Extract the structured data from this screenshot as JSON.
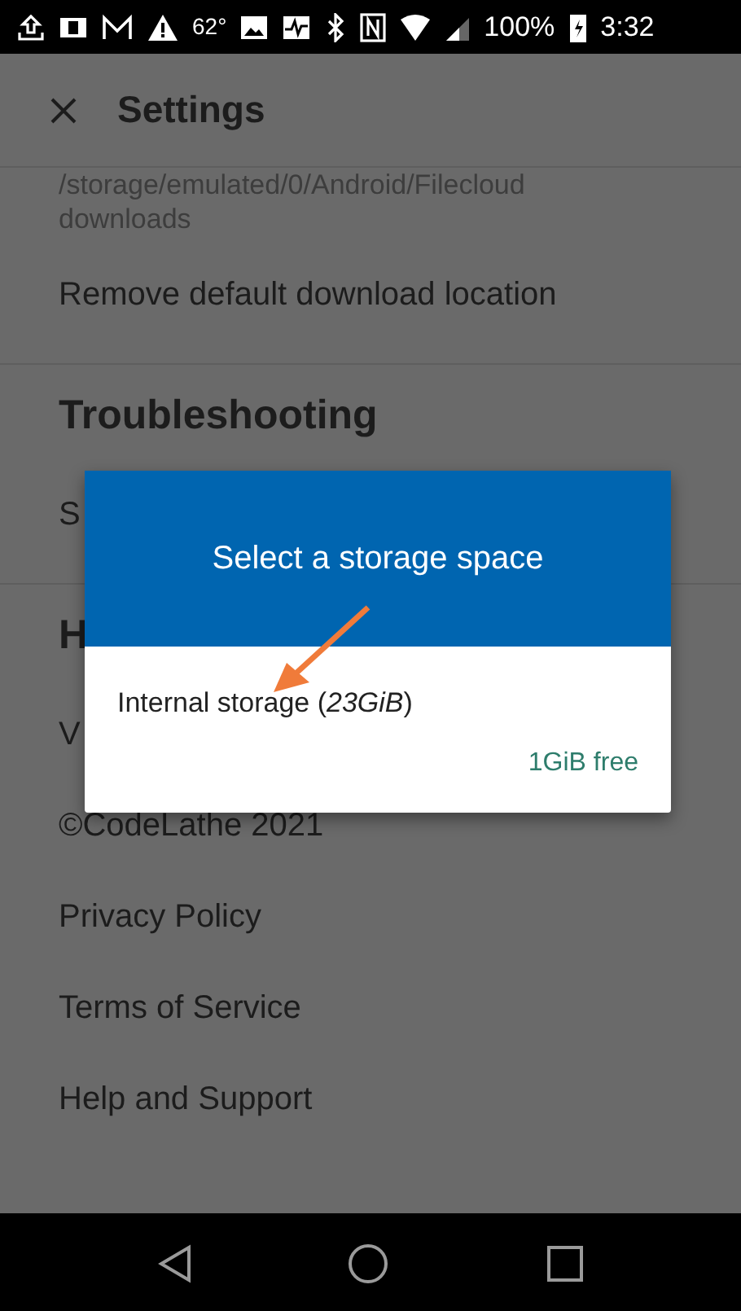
{
  "status_bar": {
    "temperature": "62°",
    "battery": "100%",
    "time": "3:32"
  },
  "header": {
    "title": "Settings"
  },
  "settings": [
    {
      "kind": "path",
      "text": "/storage/emulated/0/Android/Filecloud"
    },
    {
      "kind": "path",
      "text": "downloads"
    },
    {
      "kind": "item",
      "text": "Remove default download location"
    },
    {
      "kind": "heading",
      "text": "Troubleshooting"
    },
    {
      "kind": "item",
      "text": "S"
    },
    {
      "kind": "heading",
      "text": "H"
    },
    {
      "kind": "item",
      "text": "V"
    },
    {
      "kind": "item",
      "text": "©CodeLathe 2021"
    },
    {
      "kind": "item",
      "text": "Privacy Policy"
    },
    {
      "kind": "item",
      "text": "Terms of Service"
    },
    {
      "kind": "item",
      "text": "Help and Support"
    }
  ],
  "dialog": {
    "title": "Select a storage space",
    "options": [
      {
        "label": "Internal storage (*23GiB*)",
        "free": "1GiB free"
      }
    ]
  }
}
